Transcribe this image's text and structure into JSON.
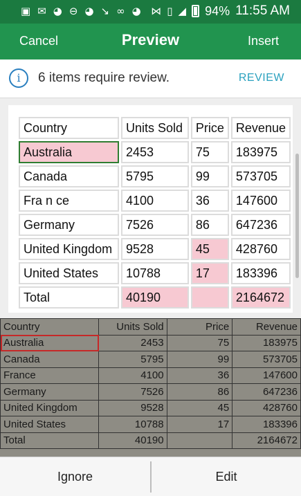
{
  "status_bar": {
    "left_icons": [
      "outlook-icon",
      "email-icon",
      "wifi-icon",
      "do-not-disturb-icon",
      "wifi-icon",
      "missed-call-icon",
      "voicemail-icon",
      "wifi-icon"
    ],
    "right_icons": [
      "bluetooth-icon",
      "vibrate-icon",
      "lte-signal-icon",
      "battery-icon"
    ],
    "battery": "94%",
    "time": "11:55 AM"
  },
  "app_bar": {
    "cancel_label": "Cancel",
    "title": "Preview",
    "insert_label": "Insert"
  },
  "banner": {
    "message": "6 items require review.",
    "review_label": "REVIEW"
  },
  "preview_table": {
    "headers": [
      "Country",
      "Units Sold",
      "Price",
      "Revenue"
    ],
    "rows": [
      [
        "Australia",
        "2453",
        "75",
        "183975"
      ],
      [
        "Canada",
        "5795",
        "99",
        "573705"
      ],
      [
        "Fra n ce",
        "4100",
        "36",
        "147600"
      ],
      [
        "Germany",
        "7526",
        "86",
        "647236"
      ],
      [
        "United Kingdom",
        "9528",
        "45",
        "428760"
      ],
      [
        "United States",
        "10788",
        "17",
        "183396"
      ],
      [
        "Total",
        "40190",
        "",
        "2164672"
      ]
    ],
    "flagged_color": "#f7c9d2",
    "selected_color": "#2f7d32"
  },
  "photo_table": {
    "headers": [
      "Country",
      "Units Sold",
      "Price",
      "Revenue"
    ],
    "rows": [
      [
        "Australia",
        "2453",
        "75",
        "183975"
      ],
      [
        "Canada",
        "5795",
        "99",
        "573705"
      ],
      [
        "France",
        "4100",
        "36",
        "147600"
      ],
      [
        "Germany",
        "7526",
        "86",
        "647236"
      ],
      [
        "United Kingdom",
        "9528",
        "45",
        "428760"
      ],
      [
        "United States",
        "10788",
        "17",
        "183396"
      ],
      [
        "Total",
        "40190",
        "",
        "2164672"
      ]
    ]
  },
  "bottom_bar": {
    "ignore_label": "Ignore",
    "edit_label": "Edit"
  },
  "colors": {
    "status_bar": "#1b7a40",
    "app_bar": "#21944f",
    "accent": "#2aa1bf"
  }
}
